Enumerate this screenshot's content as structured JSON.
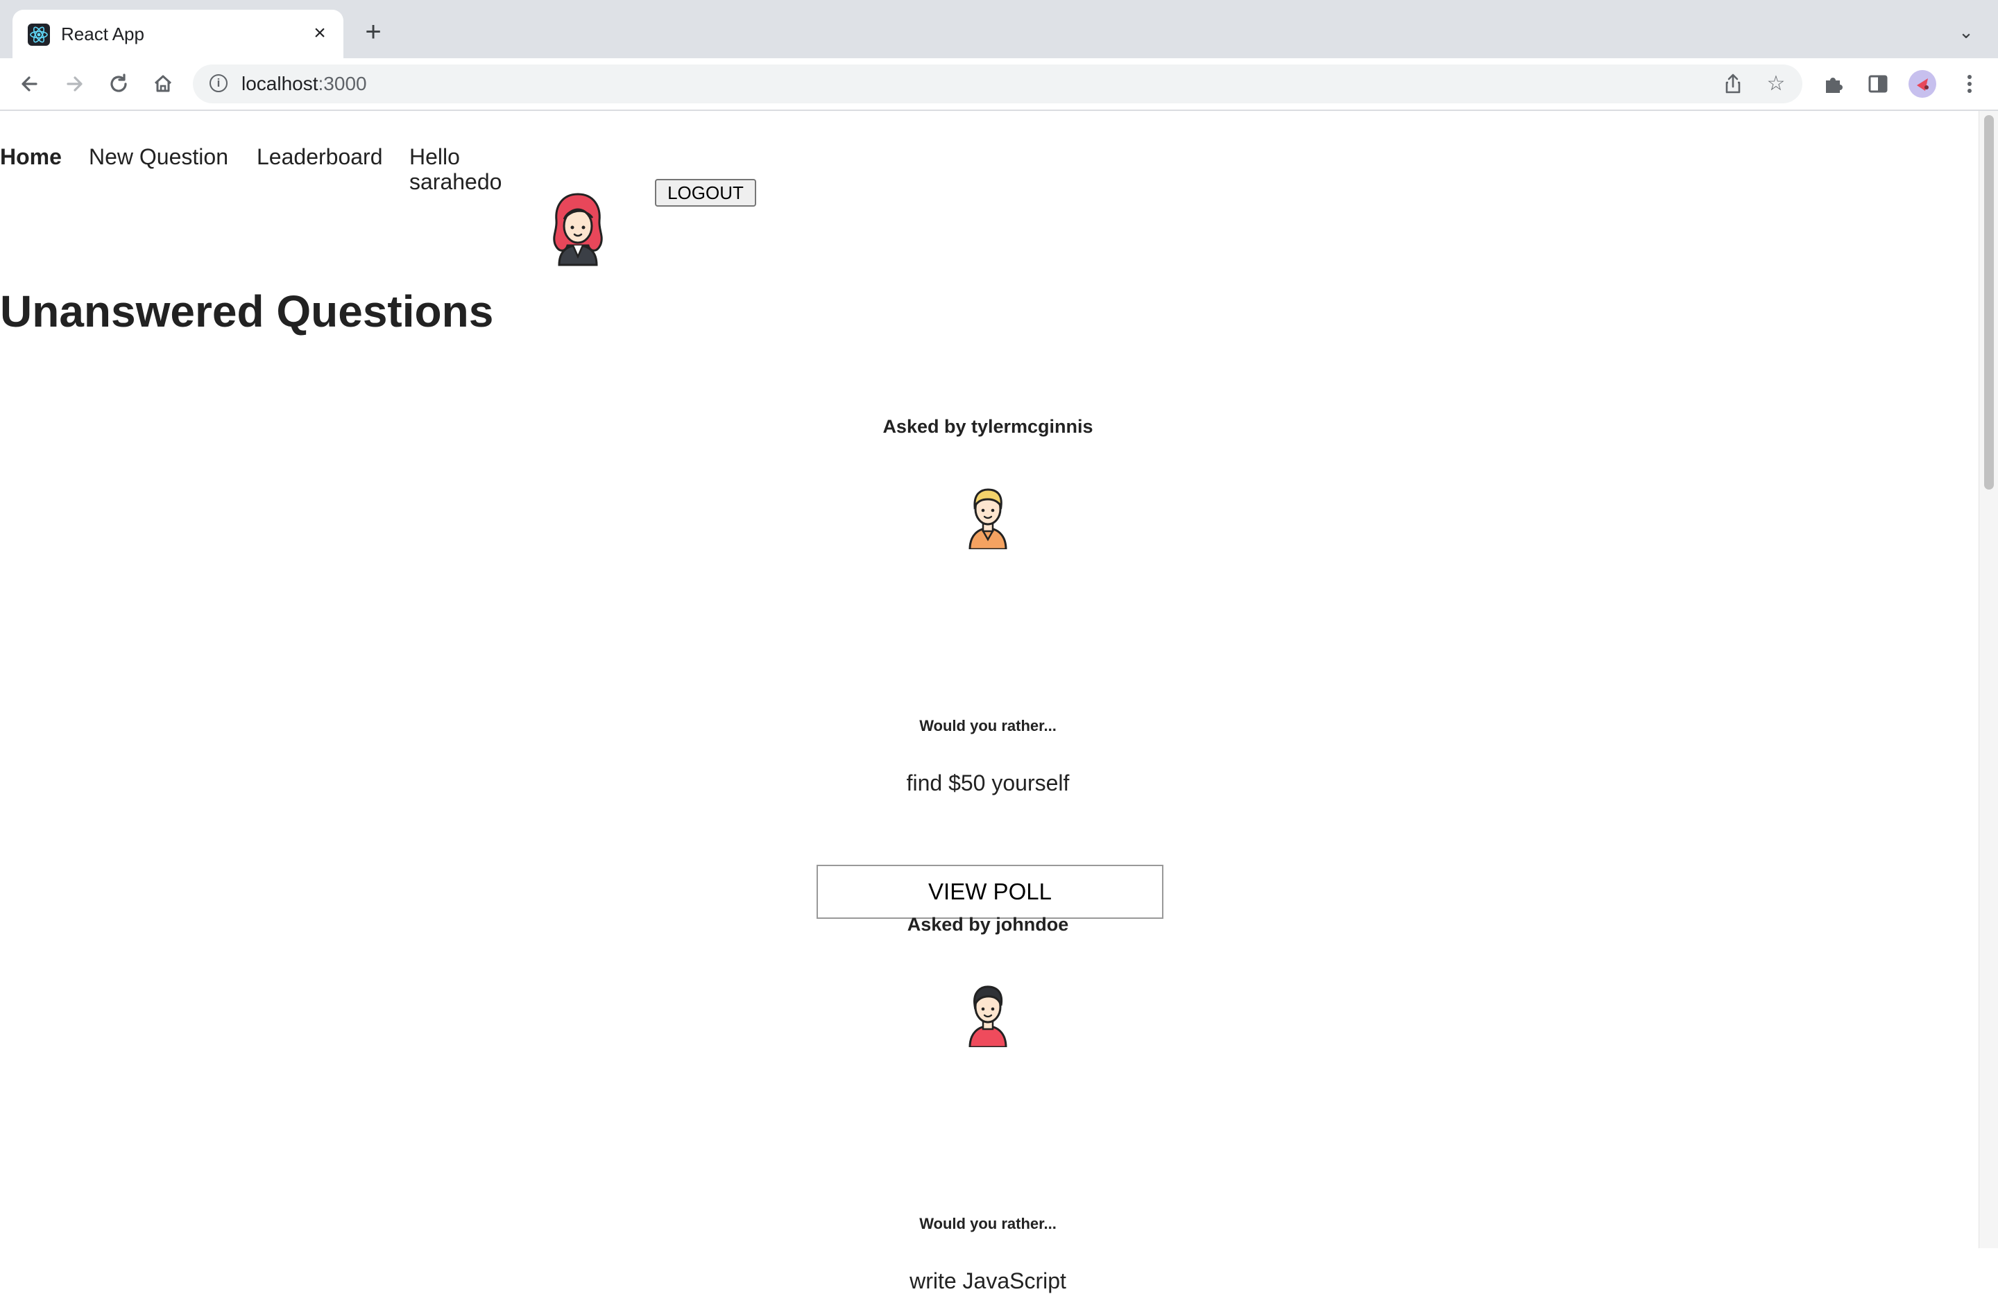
{
  "browser": {
    "tab_title": "React App",
    "new_tab_symbol": "+",
    "url_host": "localhost",
    "url_port": ":3000"
  },
  "nav": {
    "links": [
      {
        "label": "Home",
        "active": true
      },
      {
        "label": "New Question",
        "active": false
      },
      {
        "label": "Leaderboard",
        "active": false
      }
    ],
    "greeting": "Hello",
    "username": "sarahedo",
    "logout_label": "LOGOUT"
  },
  "main": {
    "heading": "Unanswered Questions",
    "questions": [
      {
        "asked_by": "Asked by tylermcginnis",
        "prompt": "Would you rather...",
        "option": "find $50 yourself",
        "button": "VIEW POLL",
        "avatar": "blond-man-avatar"
      },
      {
        "asked_by": "Asked by johndoe",
        "prompt": "Would you rather...",
        "option": "write JavaScript",
        "avatar": "dark-hair-man-avatar"
      }
    ]
  },
  "colors": {
    "tabstrip": "#dee1e6",
    "omnibox": "#f1f3f4",
    "avatar_red_hair": "#e8475a",
    "avatar_blond_hair": "#f3d36b",
    "avatar_orange_shirt": "#f4a261",
    "avatar_red_shirt": "#ef4b5c"
  }
}
